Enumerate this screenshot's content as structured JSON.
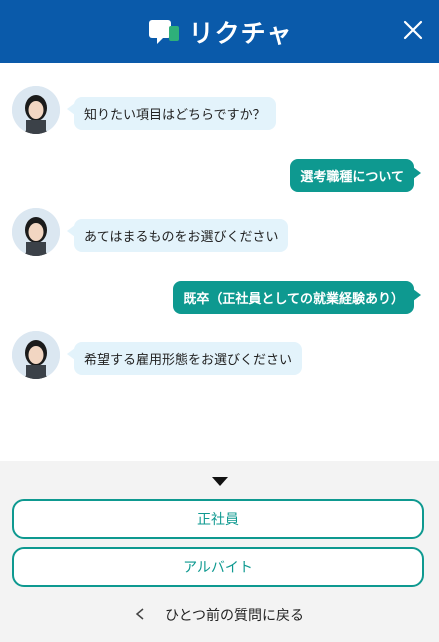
{
  "header": {
    "title": "リクチャ",
    "logo_icon": "chat-bubble-icon",
    "close_icon": "close-icon"
  },
  "colors": {
    "header_bg": "#0a5aaa",
    "bot_bubble": "#e3f3fb",
    "user_bubble": "#0e9990",
    "accent": "#0e9990"
  },
  "messages": [
    {
      "role": "bot",
      "text": "知りたい項目はどちらですか？"
    },
    {
      "role": "user",
      "text": "選考職種について"
    },
    {
      "role": "bot",
      "text": "あてはまるものをお選びください"
    },
    {
      "role": "user",
      "text": "既卒（正社員としての就業経験あり）"
    },
    {
      "role": "bot",
      "text": "希望する雇用形態をお選びください"
    }
  ],
  "options": [
    "正社員",
    "アルバイト"
  ],
  "back_label": "ひとつ前の質問に戻る"
}
